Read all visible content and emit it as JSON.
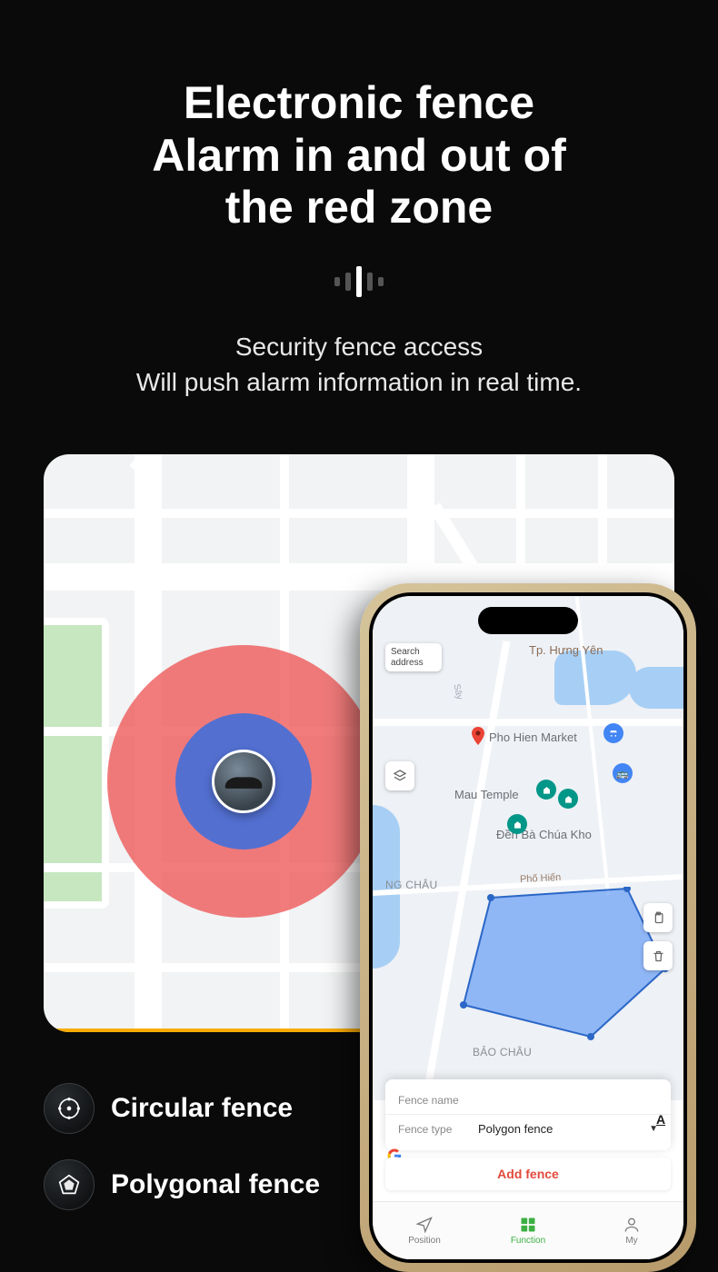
{
  "title": {
    "line1": "Electronic fence",
    "line2": "Alarm in and out of",
    "line3": "the red zone"
  },
  "subtitle": {
    "line1": "Security fence access",
    "line2": "Will push alarm information in real time."
  },
  "features": {
    "circular_label": "Circular fence",
    "polygonal_label": "Polygonal fence"
  },
  "phone": {
    "search_label": "Search address",
    "poi_market": "Pho Hien Market",
    "poi_temple": "Mau Temple",
    "poi_den": "Đền Bà Chúa Kho",
    "road_phohien": "Phố Hiến",
    "city_label": "Tp. Hưng Yên",
    "district_ngchau": "NG CHÂU",
    "district_baochau": "BẢO CHÂU",
    "form": {
      "name_placeholder": "Fence name",
      "type_label": "Fence type",
      "type_value": "Polygon fence"
    },
    "add_fence_label": "Add fence",
    "nav": {
      "position": "Position",
      "function": "Function",
      "my": "My"
    }
  }
}
